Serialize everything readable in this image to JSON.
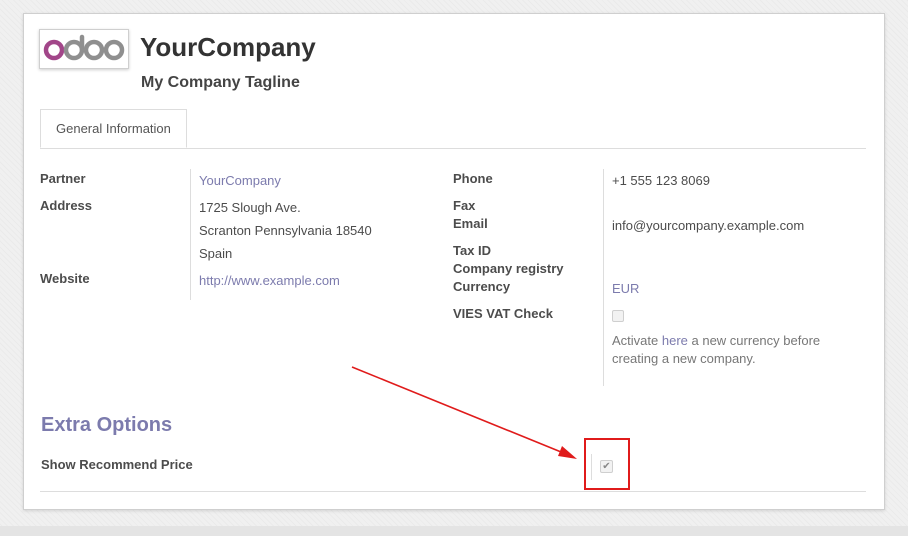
{
  "logo": {
    "text": "odoo",
    "colors": {
      "o1": "#a24689",
      "rest": "#8f8f8f"
    }
  },
  "company": {
    "name": "YourCompany",
    "tagline": "My Company Tagline"
  },
  "tabs": [
    {
      "label": "General Information",
      "active": true
    }
  ],
  "left_fields": {
    "partner": {
      "label": "Partner",
      "value": "YourCompany"
    },
    "address": {
      "label": "Address",
      "street": "1725 Slough Ave.",
      "city_line": "Scranton Pennsylvania 18540",
      "country": "Spain"
    },
    "website": {
      "label": "Website",
      "value": "http://www.example.com"
    }
  },
  "right_fields": {
    "phone": {
      "label": "Phone",
      "value": "+1 555 123 8069"
    },
    "fax": {
      "label": "Fax",
      "value": ""
    },
    "email": {
      "label": "Email",
      "value": "info@yourcompany.example.com"
    },
    "tax_id": {
      "label": "Tax ID",
      "value": ""
    },
    "company_registry": {
      "label": "Company registry",
      "value": ""
    },
    "currency": {
      "label": "Currency",
      "value": "EUR"
    },
    "vies": {
      "label": "VIES VAT Check",
      "checked": false
    },
    "help": {
      "prefix": "Activate ",
      "link": "here",
      "suffix": " a new currency before creating a new company."
    }
  },
  "extra_options": {
    "title": "Extra Options",
    "show_recommend_price": {
      "label": "Show Recommend Price",
      "checked": true,
      "check_mark": "✔"
    }
  },
  "colors": {
    "link": "#7c7bad",
    "annotation": "#e01b1b"
  }
}
